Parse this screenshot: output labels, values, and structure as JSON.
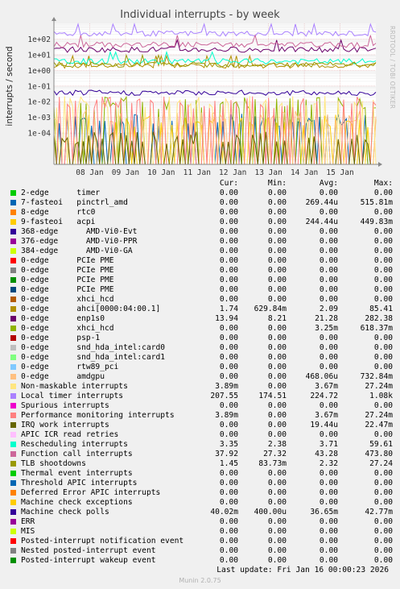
{
  "chart_data": {
    "type": "line",
    "title": "Individual interrupts - by week",
    "ylabel": "interrupts / second",
    "yscale": "log",
    "ylim": [
      1e-06,
      1000
    ],
    "yticks": [
      {
        "value": 0.0001,
        "label": "1e-04"
      },
      {
        "value": 0.001,
        "label": "1e-03"
      },
      {
        "value": 0.01,
        "label": "1e-02"
      },
      {
        "value": 0.1,
        "label": "1e-01"
      },
      {
        "value": 1,
        "label": "1e+00"
      },
      {
        "value": 10,
        "label": "1e+01"
      },
      {
        "value": 100,
        "label": "1e+02"
      }
    ],
    "xlim": [
      "2026-01-07 00:00",
      "2026-01-16 00:00"
    ],
    "xticks": [
      {
        "date": "2026-01-08",
        "label": "08 Jan"
      },
      {
        "date": "2026-01-09",
        "label": "09 Jan"
      },
      {
        "date": "2026-01-10",
        "label": "10 Jan"
      },
      {
        "date": "2026-01-11",
        "label": "11 Jan"
      },
      {
        "date": "2026-01-12",
        "label": "12 Jan"
      },
      {
        "date": "2026-01-13",
        "label": "13 Jan"
      },
      {
        "date": "2026-01-14",
        "label": "14 Jan"
      },
      {
        "date": "2026-01-15",
        "label": "15 Jan"
      }
    ],
    "grid": true,
    "columns": [
      "Cur:",
      "Min:",
      "Avg:",
      "Max:"
    ],
    "series": [
      {
        "name": "2-edge      timer",
        "color": "#00cc00",
        "cur": "0.00",
        "min": "0.00",
        "avg": "0.00",
        "max": "0.00"
      },
      {
        "name": "7-fasteoi   pinctrl_amd",
        "color": "#0066b3",
        "cur": "0.00",
        "min": "0.00",
        "avg": "269.44u",
        "max": "515.81m"
      },
      {
        "name": "8-edge      rtc0",
        "color": "#ff8000",
        "cur": "0.00",
        "min": "0.00",
        "avg": "0.00",
        "max": "0.00"
      },
      {
        "name": "9-fasteoi   acpi",
        "color": "#ffcc00",
        "cur": "0.00",
        "min": "0.00",
        "avg": "244.44u",
        "max": "449.83m"
      },
      {
        "name": "368-edge      AMD-Vi0-Evt",
        "color": "#330099",
        "cur": "0.00",
        "min": "0.00",
        "avg": "0.00",
        "max": "0.00"
      },
      {
        "name": "376-edge      AMD-Vi0-PPR",
        "color": "#990099",
        "cur": "0.00",
        "min": "0.00",
        "avg": "0.00",
        "max": "0.00"
      },
      {
        "name": "384-edge      AMD-Vi0-GA",
        "color": "#ccff00",
        "cur": "0.00",
        "min": "0.00",
        "avg": "0.00",
        "max": "0.00"
      },
      {
        "name": "0-edge      PCIe PME",
        "color": "#ff0000",
        "cur": "0.00",
        "min": "0.00",
        "avg": "0.00",
        "max": "0.00"
      },
      {
        "name": "0-edge      PCIe PME",
        "color": "#808080",
        "cur": "0.00",
        "min": "0.00",
        "avg": "0.00",
        "max": "0.00"
      },
      {
        "name": "0-edge      PCIe PME",
        "color": "#008f00",
        "cur": "0.00",
        "min": "0.00",
        "avg": "0.00",
        "max": "0.00"
      },
      {
        "name": "0-edge      PCIe PME",
        "color": "#00487d",
        "cur": "0.00",
        "min": "0.00",
        "avg": "0.00",
        "max": "0.00"
      },
      {
        "name": "0-edge      xhci_hcd",
        "color": "#b35a00",
        "cur": "0.00",
        "min": "0.00",
        "avg": "0.00",
        "max": "0.00"
      },
      {
        "name": "0-edge      ahci[0000:04:00.1]",
        "color": "#b38f00",
        "cur": "1.74",
        "min": "629.84m",
        "avg": "2.09",
        "max": "85.41"
      },
      {
        "name": "0-edge      enp1s0",
        "color": "#6b006b",
        "cur": "13.94",
        "min": "8.21",
        "avg": "21.28",
        "max": "282.38"
      },
      {
        "name": "0-edge      xhci_hcd",
        "color": "#8fb300",
        "cur": "0.00",
        "min": "0.00",
        "avg": "3.25m",
        "max": "618.37m"
      },
      {
        "name": "0-edge      psp-1",
        "color": "#b30000",
        "cur": "0.00",
        "min": "0.00",
        "avg": "0.00",
        "max": "0.00"
      },
      {
        "name": "0-edge      snd_hda_intel:card0",
        "color": "#bebebe",
        "cur": "0.00",
        "min": "0.00",
        "avg": "0.00",
        "max": "0.00"
      },
      {
        "name": "0-edge      snd_hda_intel:card1",
        "color": "#80ff80",
        "cur": "0.00",
        "min": "0.00",
        "avg": "0.00",
        "max": "0.00"
      },
      {
        "name": "0-edge      rtw89_pci",
        "color": "#80c9ff",
        "cur": "0.00",
        "min": "0.00",
        "avg": "0.00",
        "max": "0.00"
      },
      {
        "name": "0-edge      amdgpu",
        "color": "#ffc080",
        "cur": "0.00",
        "min": "0.00",
        "avg": "468.06u",
        "max": "732.84m"
      },
      {
        "name": "Non-maskable interrupts",
        "color": "#ffe680",
        "cur": "3.89m",
        "min": "0.00",
        "avg": "3.67m",
        "max": "27.24m"
      },
      {
        "name": "Local timer interrupts",
        "color": "#aa80ff",
        "cur": "207.55",
        "min": "174.51",
        "avg": "224.72",
        "max": "1.08k"
      },
      {
        "name": "Spurious interrupts",
        "color": "#ee00cc",
        "cur": "0.00",
        "min": "0.00",
        "avg": "0.00",
        "max": "0.00"
      },
      {
        "name": "Performance monitoring interrupts",
        "color": "#ff8080",
        "cur": "3.89m",
        "min": "0.00",
        "avg": "3.67m",
        "max": "27.24m"
      },
      {
        "name": "IRQ work interrupts",
        "color": "#666600",
        "cur": "0.00",
        "min": "0.00",
        "avg": "19.44u",
        "max": "22.47m"
      },
      {
        "name": "APIC ICR read retries",
        "color": "#ffbfff",
        "cur": "0.00",
        "min": "0.00",
        "avg": "0.00",
        "max": "0.00"
      },
      {
        "name": "Rescheduling interrupts",
        "color": "#00ffcc",
        "cur": "3.35",
        "min": "2.38",
        "avg": "3.71",
        "max": "59.61"
      },
      {
        "name": "Function call interrupts",
        "color": "#cc6699",
        "cur": "37.92",
        "min": "27.32",
        "avg": "43.28",
        "max": "473.80"
      },
      {
        "name": "TLB shootdowns",
        "color": "#999900",
        "cur": "1.45",
        "min": "83.73m",
        "avg": "2.32",
        "max": "27.24"
      },
      {
        "name": "Thermal event interrupts",
        "color": "#00cc00",
        "cur": "0.00",
        "min": "0.00",
        "avg": "0.00",
        "max": "0.00"
      },
      {
        "name": "Threshold APIC interrupts",
        "color": "#0066b3",
        "cur": "0.00",
        "min": "0.00",
        "avg": "0.00",
        "max": "0.00"
      },
      {
        "name": "Deferred Error APIC interrupts",
        "color": "#ff8000",
        "cur": "0.00",
        "min": "0.00",
        "avg": "0.00",
        "max": "0.00"
      },
      {
        "name": "Machine check exceptions",
        "color": "#ffcc00",
        "cur": "0.00",
        "min": "0.00",
        "avg": "0.00",
        "max": "0.00"
      },
      {
        "name": "Machine check polls",
        "color": "#330099",
        "cur": "40.02m",
        "min": "400.00u",
        "avg": "36.65m",
        "max": "42.77m"
      },
      {
        "name": "ERR",
        "color": "#990099",
        "cur": "0.00",
        "min": "0.00",
        "avg": "0.00",
        "max": "0.00"
      },
      {
        "name": "MIS",
        "color": "#ccff00",
        "cur": "0.00",
        "min": "0.00",
        "avg": "0.00",
        "max": "0.00"
      },
      {
        "name": "Posted-interrupt notification event",
        "color": "#ff0000",
        "cur": "0.00",
        "min": "0.00",
        "avg": "0.00",
        "max": "0.00"
      },
      {
        "name": "Nested posted-interrupt event",
        "color": "#808080",
        "cur": "0.00",
        "min": "0.00",
        "avg": "0.00",
        "max": "0.00"
      },
      {
        "name": "Posted-interrupt wakeup event",
        "color": "#008f00",
        "cur": "0.00",
        "min": "0.00",
        "avg": "0.00",
        "max": "0.00"
      }
    ]
  },
  "footer": {
    "last_update": "Last update: Fri Jan 16 00:00:23 2026",
    "version": "Munin 2.0.75"
  },
  "side_label": "RRDTOOL / TOBI OETIKER"
}
